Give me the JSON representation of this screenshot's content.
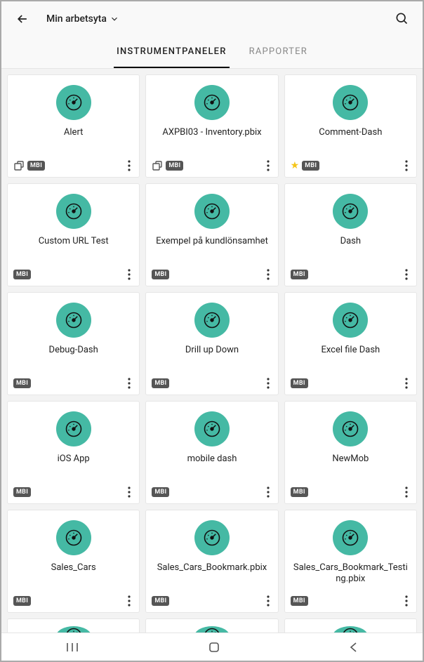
{
  "header": {
    "workspace_label": "Min arbetsyta"
  },
  "tabs": [
    {
      "label": "INSTRUMENTPANELER",
      "active": true
    },
    {
      "label": "RAPPORTER",
      "active": false
    }
  ],
  "badge_label": "MBI",
  "cards": [
    {
      "title": "Alert",
      "share": true,
      "star": false,
      "mbi": true
    },
    {
      "title": "AXPBI03 - Inventory.pbix",
      "share": true,
      "star": false,
      "mbi": true
    },
    {
      "title": "Comment-Dash",
      "share": false,
      "star": true,
      "mbi": true
    },
    {
      "title": "Custom URL Test",
      "share": false,
      "star": false,
      "mbi": true
    },
    {
      "title": "Exempel på kundlönsamhet",
      "share": false,
      "star": false,
      "mbi": true
    },
    {
      "title": "Dash",
      "share": false,
      "star": false,
      "mbi": true
    },
    {
      "title": "Debug-Dash",
      "share": false,
      "star": false,
      "mbi": true
    },
    {
      "title": "Drill up Down",
      "share": false,
      "star": false,
      "mbi": true
    },
    {
      "title": "Excel file Dash",
      "share": false,
      "star": false,
      "mbi": true
    },
    {
      "title": "iOS App",
      "share": false,
      "star": false,
      "mbi": true
    },
    {
      "title": "mobile dash",
      "share": false,
      "star": false,
      "mbi": true
    },
    {
      "title": "NewMob",
      "share": false,
      "star": false,
      "mbi": true
    },
    {
      "title": "Sales_Cars",
      "share": false,
      "star": false,
      "mbi": true
    },
    {
      "title": "Sales_Cars_Bookmark.pbix",
      "share": false,
      "star": false,
      "mbi": true
    },
    {
      "title": "Sales_Cars_Bookmark_Testing.pbix",
      "share": false,
      "star": false,
      "mbi": true
    }
  ],
  "colors": {
    "accent": "#45B9A4"
  }
}
